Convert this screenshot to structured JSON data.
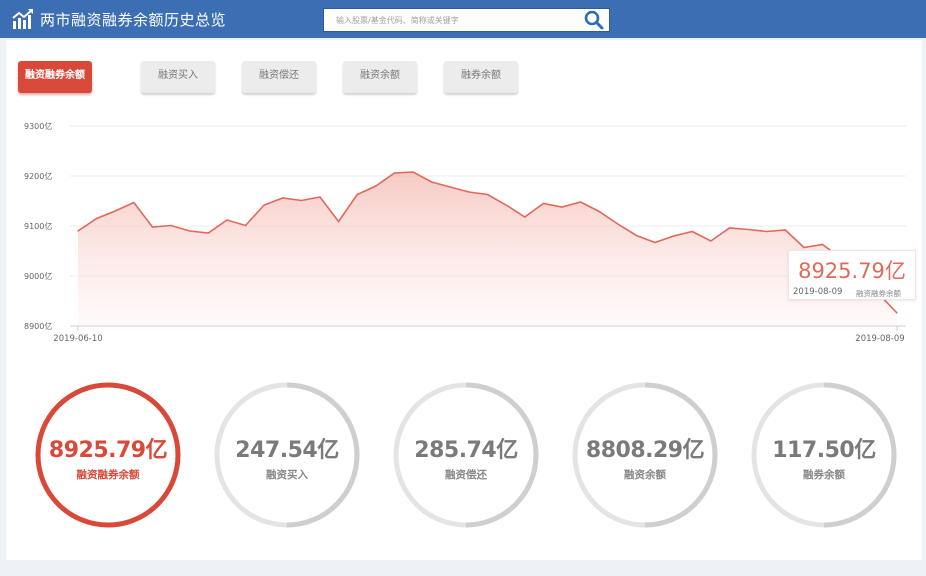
{
  "header": {
    "title": "两市融资融券余额历史总览",
    "search_placeholder": "输入股票/基金代码、简称或关键字"
  },
  "tabs": [
    {
      "label": "融资融券余额",
      "active": true
    },
    {
      "label": "融资买入",
      "active": false
    },
    {
      "label": "融资偿还",
      "active": false
    },
    {
      "label": "融资余额",
      "active": false
    },
    {
      "label": "融券余额",
      "active": false
    }
  ],
  "chart_data": {
    "type": "area",
    "ylim": [
      8900,
      9300
    ],
    "y_ticks": [
      9300,
      9200,
      9100,
      9000,
      8900
    ],
    "y_tick_labels": [
      "9300亿",
      "9200亿",
      "9100亿",
      "9000亿",
      "8900亿"
    ],
    "x_start_label": "2019-06-10",
    "x_end_label": "2019-08-09",
    "grid": true,
    "series": [
      {
        "values": [
          9090,
          9115,
          9130,
          9147,
          9098,
          9101,
          9090,
          9086,
          9112,
          9101,
          9142,
          9156,
          9151,
          9158,
          9109,
          9163,
          9180,
          9206,
          9208,
          9188,
          9178,
          9168,
          9163,
          9142,
          9118,
          9145,
          9138,
          9148,
          9129,
          9104,
          9081,
          9067,
          9080,
          9089,
          9070,
          9096,
          9093,
          9089,
          9092,
          9057,
          9063,
          9035,
          9020,
          8965,
          8926
        ],
        "color": "#e0695b"
      }
    ]
  },
  "tooltip": {
    "value": "8925.79亿",
    "date": "2019-08-09",
    "label": "融资融券余额"
  },
  "rings": [
    {
      "value": "8925.79亿",
      "label": "融资融券余额",
      "active": true,
      "fraction": 1.0
    },
    {
      "value": "247.54亿",
      "label": "融资买入",
      "active": false,
      "fraction": 0.5
    },
    {
      "value": "285.74亿",
      "label": "融资偿还",
      "active": false,
      "fraction": 0.5
    },
    {
      "value": "8808.29亿",
      "label": "融资余额",
      "active": false,
      "fraction": 0.5
    },
    {
      "value": "117.50亿",
      "label": "融券余额",
      "active": false,
      "fraction": 0.5
    }
  ],
  "colors": {
    "header": "#3c6eb4",
    "accent": "#d9493a",
    "line": "#e0695b",
    "ring_track": "#e4e4e4",
    "ring_progress": "#cfcfcf"
  }
}
